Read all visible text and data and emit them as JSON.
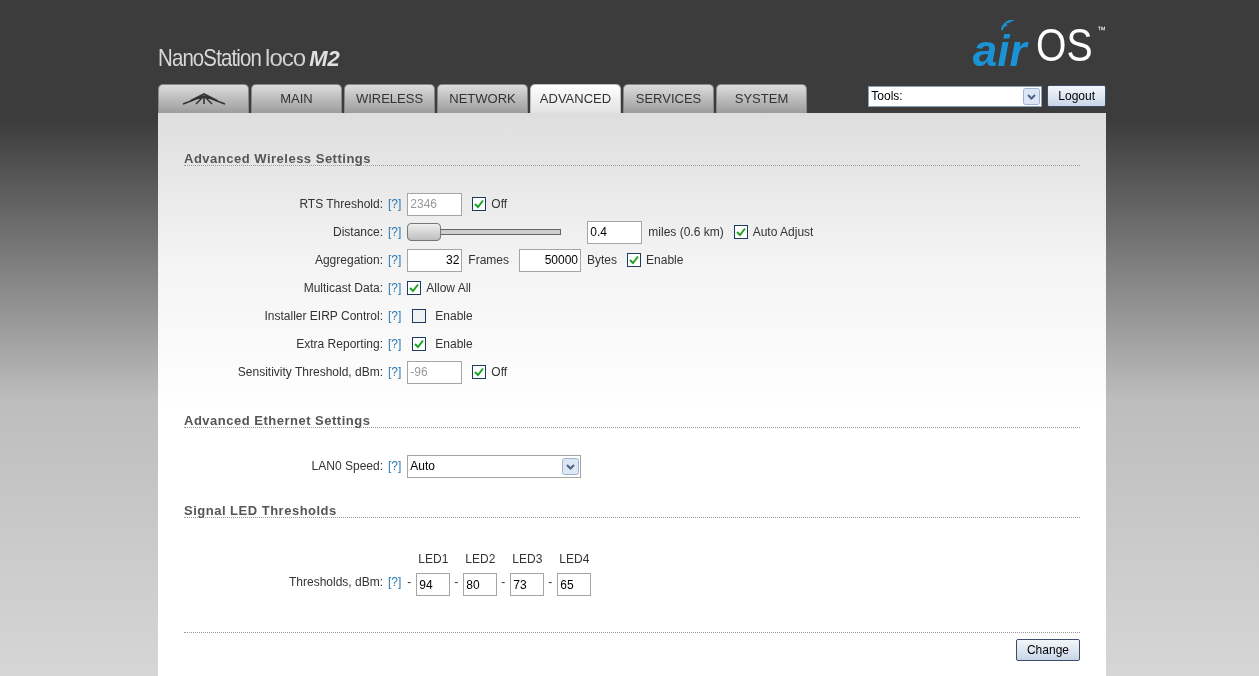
{
  "header": {
    "product": "NanoStation",
    "model": "loco",
    "variant": "M2",
    "brand_air": "air",
    "brand_os": "OS",
    "trademark": "™"
  },
  "tabs": [
    {
      "kind": "logo",
      "selected": false
    },
    {
      "kind": "text",
      "label": "MAIN",
      "selected": false
    },
    {
      "kind": "text",
      "label": "WIRELESS",
      "selected": false
    },
    {
      "kind": "text",
      "label": "NETWORK",
      "selected": false
    },
    {
      "kind": "text",
      "label": "ADVANCED",
      "selected": true
    },
    {
      "kind": "text",
      "label": "SERVICES",
      "selected": false
    },
    {
      "kind": "text",
      "label": "SYSTEM",
      "selected": false
    }
  ],
  "tools": {
    "value": "Tools:"
  },
  "logout": "Logout",
  "sections": [
    {
      "title": "Advanced Wireless Settings",
      "rows": [
        {
          "label": "RTS Threshold:",
          "help": "[?]",
          "parts": [
            {
              "kind": "field",
              "value": "2346",
              "disabled": true
            },
            {
              "kind": "check",
              "checked": true,
              "label": "Off"
            }
          ]
        },
        {
          "label": "Distance:",
          "help": "[?]",
          "parts": [
            {
              "kind": "slider",
              "level": 0
            },
            {
              "kind": "field",
              "value": "0.4",
              "disabled": false
            },
            {
              "kind": "text",
              "text": "miles (0.6 km)"
            },
            {
              "kind": "check",
              "checked": true,
              "label": "Auto Adjust"
            }
          ]
        },
        {
          "label": "Aggregation:",
          "help": "[?]",
          "parts": [
            {
              "kind": "number_field",
              "value": "32",
              "disabled": false
            },
            {
              "kind": "text",
              "text": "Frames"
            },
            {
              "kind": "number_field",
              "value": "50000",
              "disabled": false
            },
            {
              "kind": "text",
              "text": "Bytes"
            },
            {
              "kind": "check",
              "checked": true,
              "label": "Enable"
            }
          ]
        },
        {
          "label": "Multicast Data:",
          "help": "[?]",
          "parts": [
            {
              "kind": "check",
              "checked": true,
              "label": "Allow All"
            }
          ]
        },
        {
          "label": "Installer EIRP Control:",
          "help": "[?]",
          "parts": [
            {
              "kind": "check",
              "checked": false,
              "label": "Enable"
            }
          ]
        },
        {
          "label": "Extra Reporting:",
          "help": "[?]",
          "parts": [
            {
              "kind": "check",
              "checked": true,
              "label": "Enable"
            }
          ]
        },
        {
          "label": "Sensitivity Threshold, dBm:",
          "help": "[?]",
          "parts": [
            {
              "kind": "field",
              "value": "-96",
              "disabled": true
            },
            {
              "kind": "check",
              "checked": true,
              "label": "Off"
            }
          ]
        }
      ]
    },
    {
      "title": "Advanced Ethernet Settings",
      "rows": [
        {
          "label": "LAN0 Speed:",
          "help": "[?]",
          "parts": [
            {
              "kind": "select",
              "value": "Auto"
            }
          ]
        }
      ]
    },
    {
      "title": "Signal LED Thresholds",
      "rows": [
        {
          "label": "Thresholds, dBm:",
          "help": "[?]",
          "parts": [
            {
              "kind": "leds",
              "leds": [
                {
                  "name": "LED1",
                  "dash": "-",
                  "value": "94"
                },
                {
                  "name": "LED2",
                  "dash": "-",
                  "value": "80"
                },
                {
                  "name": "LED3",
                  "dash": "-",
                  "value": "73"
                },
                {
                  "name": "LED4",
                  "dash": "-",
                  "value": "65"
                }
              ]
            }
          ]
        }
      ]
    }
  ],
  "change": "Change"
}
